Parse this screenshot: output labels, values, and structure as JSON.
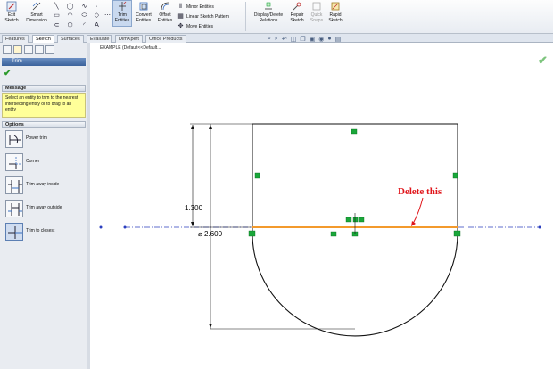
{
  "ribbon": {
    "exit_sketch": "Exit\nSketch",
    "smart_dimension": "Smart\nDimension",
    "trim_entities": "Trim\nEntities",
    "convert_entities": "Convert\nEntities",
    "offset_entities": "Offset\nEntities",
    "mirror_entities": "Mirror Entities",
    "linear_sketch_pattern": "Linear Sketch Pattern",
    "move_entities": "Move Entities",
    "display_delete_relations": "Display/Delete\nRelations",
    "repair_sketch": "Repair\nSketch",
    "quick_snaps": "Quick\nSnaps",
    "rapid_sketch": "Rapid\nSketch"
  },
  "tabs": [
    "Features",
    "Sketch",
    "Surfaces",
    "Evaluate",
    "DimXpert",
    "Office Products"
  ],
  "active_tab": "Sketch",
  "tree": {
    "label": "EXAMPLE (Default<<Default..."
  },
  "property_manager": {
    "title": "Trim",
    "message_header": "Message",
    "message": "Select an entity to trim to the nearest intersecting entity or to drag to an entity",
    "options_header": "Options",
    "options": [
      {
        "label": "Power trim"
      },
      {
        "label": "Corner"
      },
      {
        "label": "Trim away inside"
      },
      {
        "label": "Trim away outside"
      },
      {
        "label": "Trim to closest"
      }
    ],
    "selected_option": "Trim to closest"
  },
  "sketch": {
    "dim_height": "1.300",
    "dim_diameter": "⌀ 2.600",
    "annotation": "Delete this",
    "annotation_color": "#e0161b",
    "selected_line_color": "#f39a2c",
    "relation_color": "#1aa73a"
  }
}
